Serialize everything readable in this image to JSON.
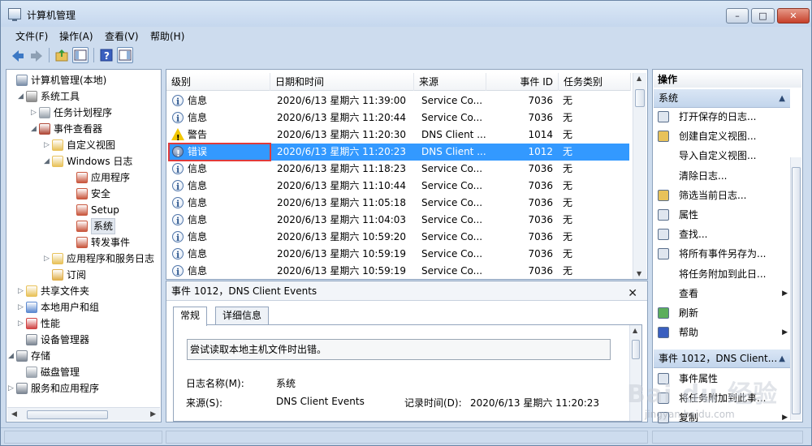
{
  "window": {
    "title": "计算机管理"
  },
  "window_buttons": {
    "minimize": "–",
    "maximize": "□",
    "close": "✕"
  },
  "menu": [
    "文件(F)",
    "操作(A)",
    "查看(V)",
    "帮助(H)"
  ],
  "tree": [
    {
      "label": "计算机管理(本地)",
      "exp": "",
      "icon": "computer-icon",
      "color": "#7a8ea8"
    },
    {
      "label": "系统工具",
      "exp": "◢",
      "icon": "tools-icon",
      "color": "#8a8a8a"
    },
    {
      "label": "任务计划程序",
      "exp": "▷",
      "icon": "clock-icon",
      "color": "#9aa3ad"
    },
    {
      "label": "事件查看器",
      "exp": "◢",
      "icon": "event-viewer-icon",
      "color": "#b04a3a"
    },
    {
      "label": "自定义视图",
      "exp": "▷",
      "icon": "folder-icon",
      "color": "#e8c25a"
    },
    {
      "label": "Windows 日志",
      "exp": "◢",
      "icon": "folder-icon",
      "color": "#e8c25a"
    },
    {
      "label": "应用程序",
      "exp": "",
      "icon": "log-icon",
      "color": "#c9583f"
    },
    {
      "label": "安全",
      "exp": "",
      "icon": "log-icon",
      "color": "#c9583f"
    },
    {
      "label": "Setup",
      "exp": "",
      "icon": "log-icon",
      "color": "#c9583f"
    },
    {
      "label": "系统",
      "exp": "",
      "icon": "log-icon",
      "color": "#c9583f",
      "selected": true
    },
    {
      "label": "转发事件",
      "exp": "",
      "icon": "log-icon",
      "color": "#c9583f"
    },
    {
      "label": "应用程序和服务日志",
      "exp": "▷",
      "icon": "folder-icon",
      "color": "#e8c25a"
    },
    {
      "label": "订阅",
      "exp": "",
      "icon": "subscription-icon",
      "color": "#e0b04d"
    },
    {
      "label": "共享文件夹",
      "exp": "▷",
      "icon": "shared-folder-icon",
      "color": "#e8c25a"
    },
    {
      "label": "本地用户和组",
      "exp": "▷",
      "icon": "users-icon",
      "color": "#5d8ad0"
    },
    {
      "label": "性能",
      "exp": "▷",
      "icon": "performance-icon",
      "color": "#d04444"
    },
    {
      "label": "设备管理器",
      "exp": "",
      "icon": "device-manager-icon",
      "color": "#7d8794"
    },
    {
      "label": "存储",
      "exp": "◢",
      "icon": "storage-icon",
      "color": "#7d8794"
    },
    {
      "label": "磁盘管理",
      "exp": "",
      "icon": "disk-icon",
      "color": "#9aa3ad"
    },
    {
      "label": "服务和应用程序",
      "exp": "▷",
      "icon": "services-icon",
      "color": "#7d8794"
    }
  ],
  "events": {
    "columns": [
      "级别",
      "日期和时间",
      "来源",
      "事件 ID",
      "任务类别"
    ],
    "rows": [
      {
        "level": "信息",
        "type": "info",
        "datetime": "2020/6/13 星期六 11:39:00",
        "source": "Service Co...",
        "id": "7036",
        "category": "无"
      },
      {
        "level": "信息",
        "type": "info",
        "datetime": "2020/6/13 星期六 11:20:44",
        "source": "Service Co...",
        "id": "7036",
        "category": "无"
      },
      {
        "level": "警告",
        "type": "warning",
        "datetime": "2020/6/13 星期六 11:20:30",
        "source": "DNS Client ...",
        "id": "1014",
        "category": "无"
      },
      {
        "level": "错误",
        "type": "error",
        "datetime": "2020/6/13 星期六 11:20:23",
        "source": "DNS Client ...",
        "id": "1012",
        "category": "无",
        "selected": true
      },
      {
        "level": "信息",
        "type": "info",
        "datetime": "2020/6/13 星期六 11:18:23",
        "source": "Service Co...",
        "id": "7036",
        "category": "无"
      },
      {
        "level": "信息",
        "type": "info",
        "datetime": "2020/6/13 星期六 11:10:44",
        "source": "Service Co...",
        "id": "7036",
        "category": "无"
      },
      {
        "level": "信息",
        "type": "info",
        "datetime": "2020/6/13 星期六 11:05:18",
        "source": "Service Co...",
        "id": "7036",
        "category": "无"
      },
      {
        "level": "信息",
        "type": "info",
        "datetime": "2020/6/13 星期六 11:04:03",
        "source": "Service Co...",
        "id": "7036",
        "category": "无"
      },
      {
        "level": "信息",
        "type": "info",
        "datetime": "2020/6/13 星期六 10:59:20",
        "source": "Service Co...",
        "id": "7036",
        "category": "无"
      },
      {
        "level": "信息",
        "type": "info",
        "datetime": "2020/6/13 星期六 10:59:19",
        "source": "Service Co...",
        "id": "7036",
        "category": "无"
      },
      {
        "level": "信息",
        "type": "info",
        "datetime": "2020/6/13 星期六 10:59:19",
        "source": "Service Co...",
        "id": "7036",
        "category": "无"
      }
    ]
  },
  "detail": {
    "header": "事件 1012，DNS Client Events",
    "close": "✕",
    "tabs": [
      "常规",
      "详细信息"
    ],
    "description": "尝试读取本地主机文件时出错。",
    "log_name_label": "日志名称(M):",
    "log_name_value": "系统",
    "source_label": "来源(S):",
    "source_value": "DNS Client Events",
    "recorded_label": "记录时间(D):",
    "recorded_value": "2020/6/13 星期六 11:20:23"
  },
  "actions": {
    "header": "操作",
    "group1": "系统",
    "items1": [
      {
        "label": "打开保存的日志...",
        "icon": "open-log-icon"
      },
      {
        "label": "创建自定义视图...",
        "icon": "filter-create-icon"
      },
      {
        "label": "导入自定义视图...",
        "icon": ""
      },
      {
        "label": "清除日志...",
        "icon": ""
      },
      {
        "label": "筛选当前日志...",
        "icon": "filter-icon"
      },
      {
        "label": "属性",
        "icon": "properties-icon"
      },
      {
        "label": "查找...",
        "icon": "find-icon"
      },
      {
        "label": "将所有事件另存为...",
        "icon": "save-icon"
      },
      {
        "label": "将任务附加到此日...",
        "icon": ""
      },
      {
        "label": "查看",
        "icon": "",
        "submenu": true
      },
      {
        "label": "刷新",
        "icon": "refresh-icon"
      },
      {
        "label": "帮助",
        "icon": "help-icon",
        "submenu": true
      }
    ],
    "group2": "事件 1012，DNS Client...",
    "items2": [
      {
        "label": "事件属性",
        "icon": "event-properties-icon"
      },
      {
        "label": "将任务附加到此事...",
        "icon": "attach-task-icon"
      },
      {
        "label": "复制",
        "icon": "copy-icon",
        "submenu": true
      }
    ]
  },
  "watermark": {
    "logo": "Bai du 经验",
    "url": "jingyan.baidu.com"
  }
}
